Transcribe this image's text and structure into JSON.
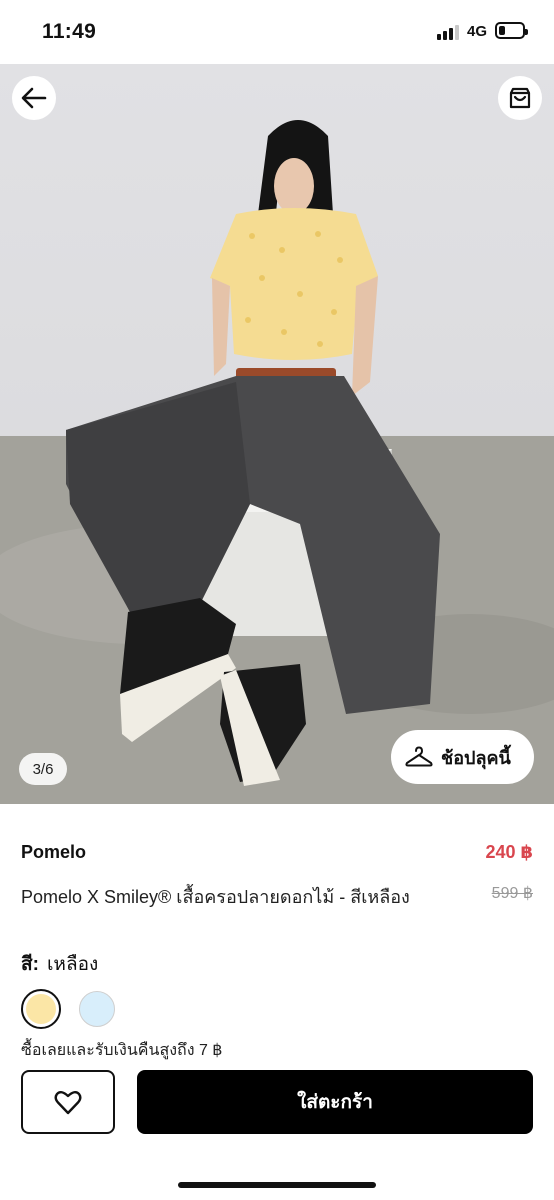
{
  "status": {
    "time": "11:49",
    "network": "4G",
    "battery_percent": 20
  },
  "gallery": {
    "counter": "3/6",
    "try_on_label": "ช้อปลุคนี้"
  },
  "product": {
    "brand": "Pomelo",
    "name": "Pomelo X Smiley® เสื้อครอปลายดอกไม้ - สีเหลือง",
    "price": "240 ฿",
    "original_price": "599 ฿"
  },
  "color": {
    "label": "สี:",
    "selected": "เหลือง",
    "options": [
      {
        "name": "yellow",
        "hex": "#fbe6a6"
      },
      {
        "name": "light-blue",
        "hex": "#d8eefb"
      }
    ]
  },
  "cashback_text": "ซื้อเลยและรับเงินคืนสูงถึง 7 ฿",
  "actions": {
    "add_to_cart_label": "ใส่ตะกร้า"
  },
  "colors": {
    "price": "#d9464e",
    "primary_button": "#000000"
  },
  "icons": [
    "arrow-left-icon",
    "shopping-bag-icon",
    "hanger-icon",
    "heart-icon"
  ]
}
